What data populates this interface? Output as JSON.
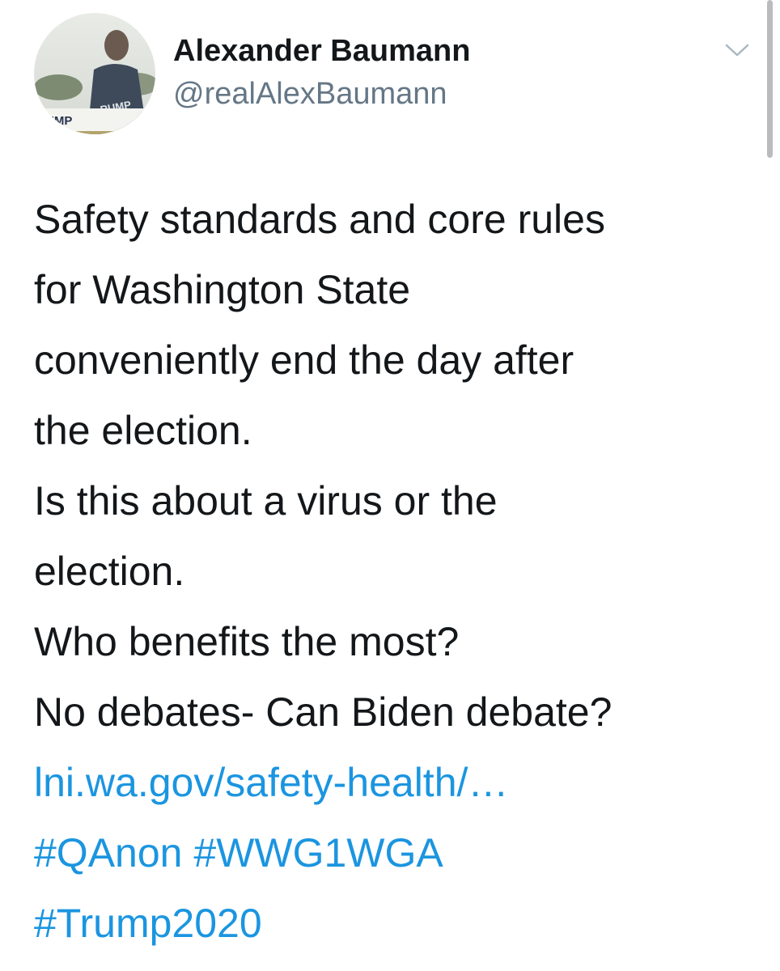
{
  "tweet": {
    "author": {
      "display_name": "Alexander Baumann",
      "handle": "@realAlexBaumann",
      "avatar_sign_text": "UMP",
      "avatar_shirt_text": "RUMP"
    },
    "menu_icon": "chevron-down-icon",
    "text_lines": [
      "Safety standards and core rules",
      "for Washington State",
      "conveniently end the day after",
      "the election.",
      "Is this about a virus or the",
      "election.",
      "Who benefits the most?",
      "No debates- Can Biden debate?"
    ],
    "link": "lni.wa.gov/safety-health/…",
    "hashtags": [
      "#QAnon",
      "#WWG1WGA",
      "#Trump2020"
    ]
  },
  "colors": {
    "text": "#14171a",
    "secondary": "#657786",
    "link": "#1b95e0"
  }
}
